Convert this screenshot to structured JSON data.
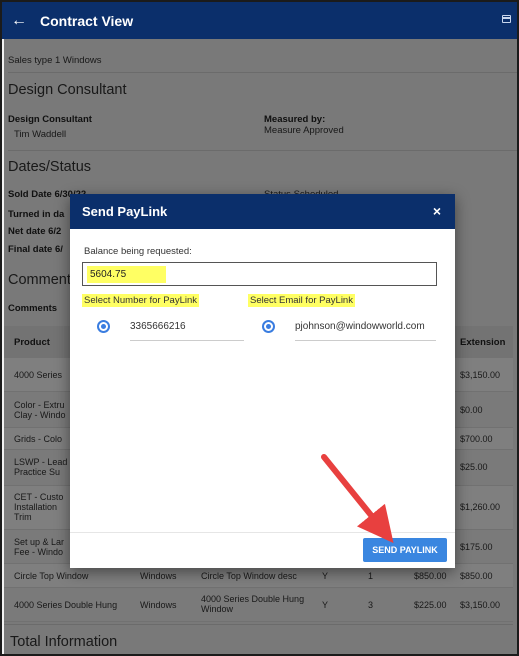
{
  "appbar": {
    "title": "Contract View"
  },
  "sales_type": "Sales type 1 Windows",
  "design": {
    "heading": "Design Consultant",
    "consultant_label": "Design Consultant",
    "consultant_value": "Tim Waddell",
    "measured_label": "Measured by:",
    "measured_value": "Measure Approved"
  },
  "dates": {
    "heading": "Dates/Status",
    "sold": "Sold Date 6/30/22",
    "turned": "Turned in da",
    "net": "Net date 6/2",
    "final": "Final date 6/",
    "status": "Status Scheduled"
  },
  "comments": {
    "heading": "Comment",
    "label": "Comments"
  },
  "table": {
    "headers": {
      "product": "Product",
      "extension": "Extension"
    },
    "rows": [
      {
        "product": [
          "4000 Series"
        ],
        "extension": "$3,150.00"
      },
      {
        "product": [
          "Color - Extru",
          "Clay - Windo"
        ],
        "extension": "$0.00"
      },
      {
        "product": [
          "Grids - Colo"
        ],
        "extension": "$700.00"
      },
      {
        "product": [
          "LSWP - Lead",
          "Practice Su"
        ],
        "extension": "$25.00"
      },
      {
        "product": [
          "CET - Custo",
          "Installation",
          "Trim"
        ],
        "extension": "$1,260.00"
      },
      {
        "product": [
          "Set up & Lar",
          "Fee - Windo"
        ],
        "extension": "$175.00"
      }
    ],
    "full_rows": [
      {
        "product": "Circle Top Window",
        "type": "Windows",
        "description": [
          "Circle Top Window desc"
        ],
        "flag": "Y",
        "qty": "1",
        "unit": "$850.00",
        "extension": "$850.00"
      },
      {
        "product": "4000 Series Double Hung",
        "type": "Windows",
        "description": [
          "4000 Series Double Hung",
          "Window"
        ],
        "flag": "Y",
        "qty": "3",
        "unit": "$225.00",
        "extension": "$3,150.00"
      }
    ]
  },
  "total": {
    "heading": "Total Information"
  },
  "dialog": {
    "title": "Send PayLink",
    "close": "×",
    "balance_label": "Balance being requested:",
    "balance_value": "5604.75",
    "number_label": "Select Number for PayLink",
    "email_label": "Select Email for PayLink",
    "number_value": "3365666216",
    "email_value": "pjohnson@windowworld.com",
    "send_label": "SEND PAYLINK"
  },
  "colors": {
    "appbar": "#0b2f6b",
    "accent": "#3a86e0",
    "highlight": "#ffff63",
    "arrow": "#e8403f"
  }
}
